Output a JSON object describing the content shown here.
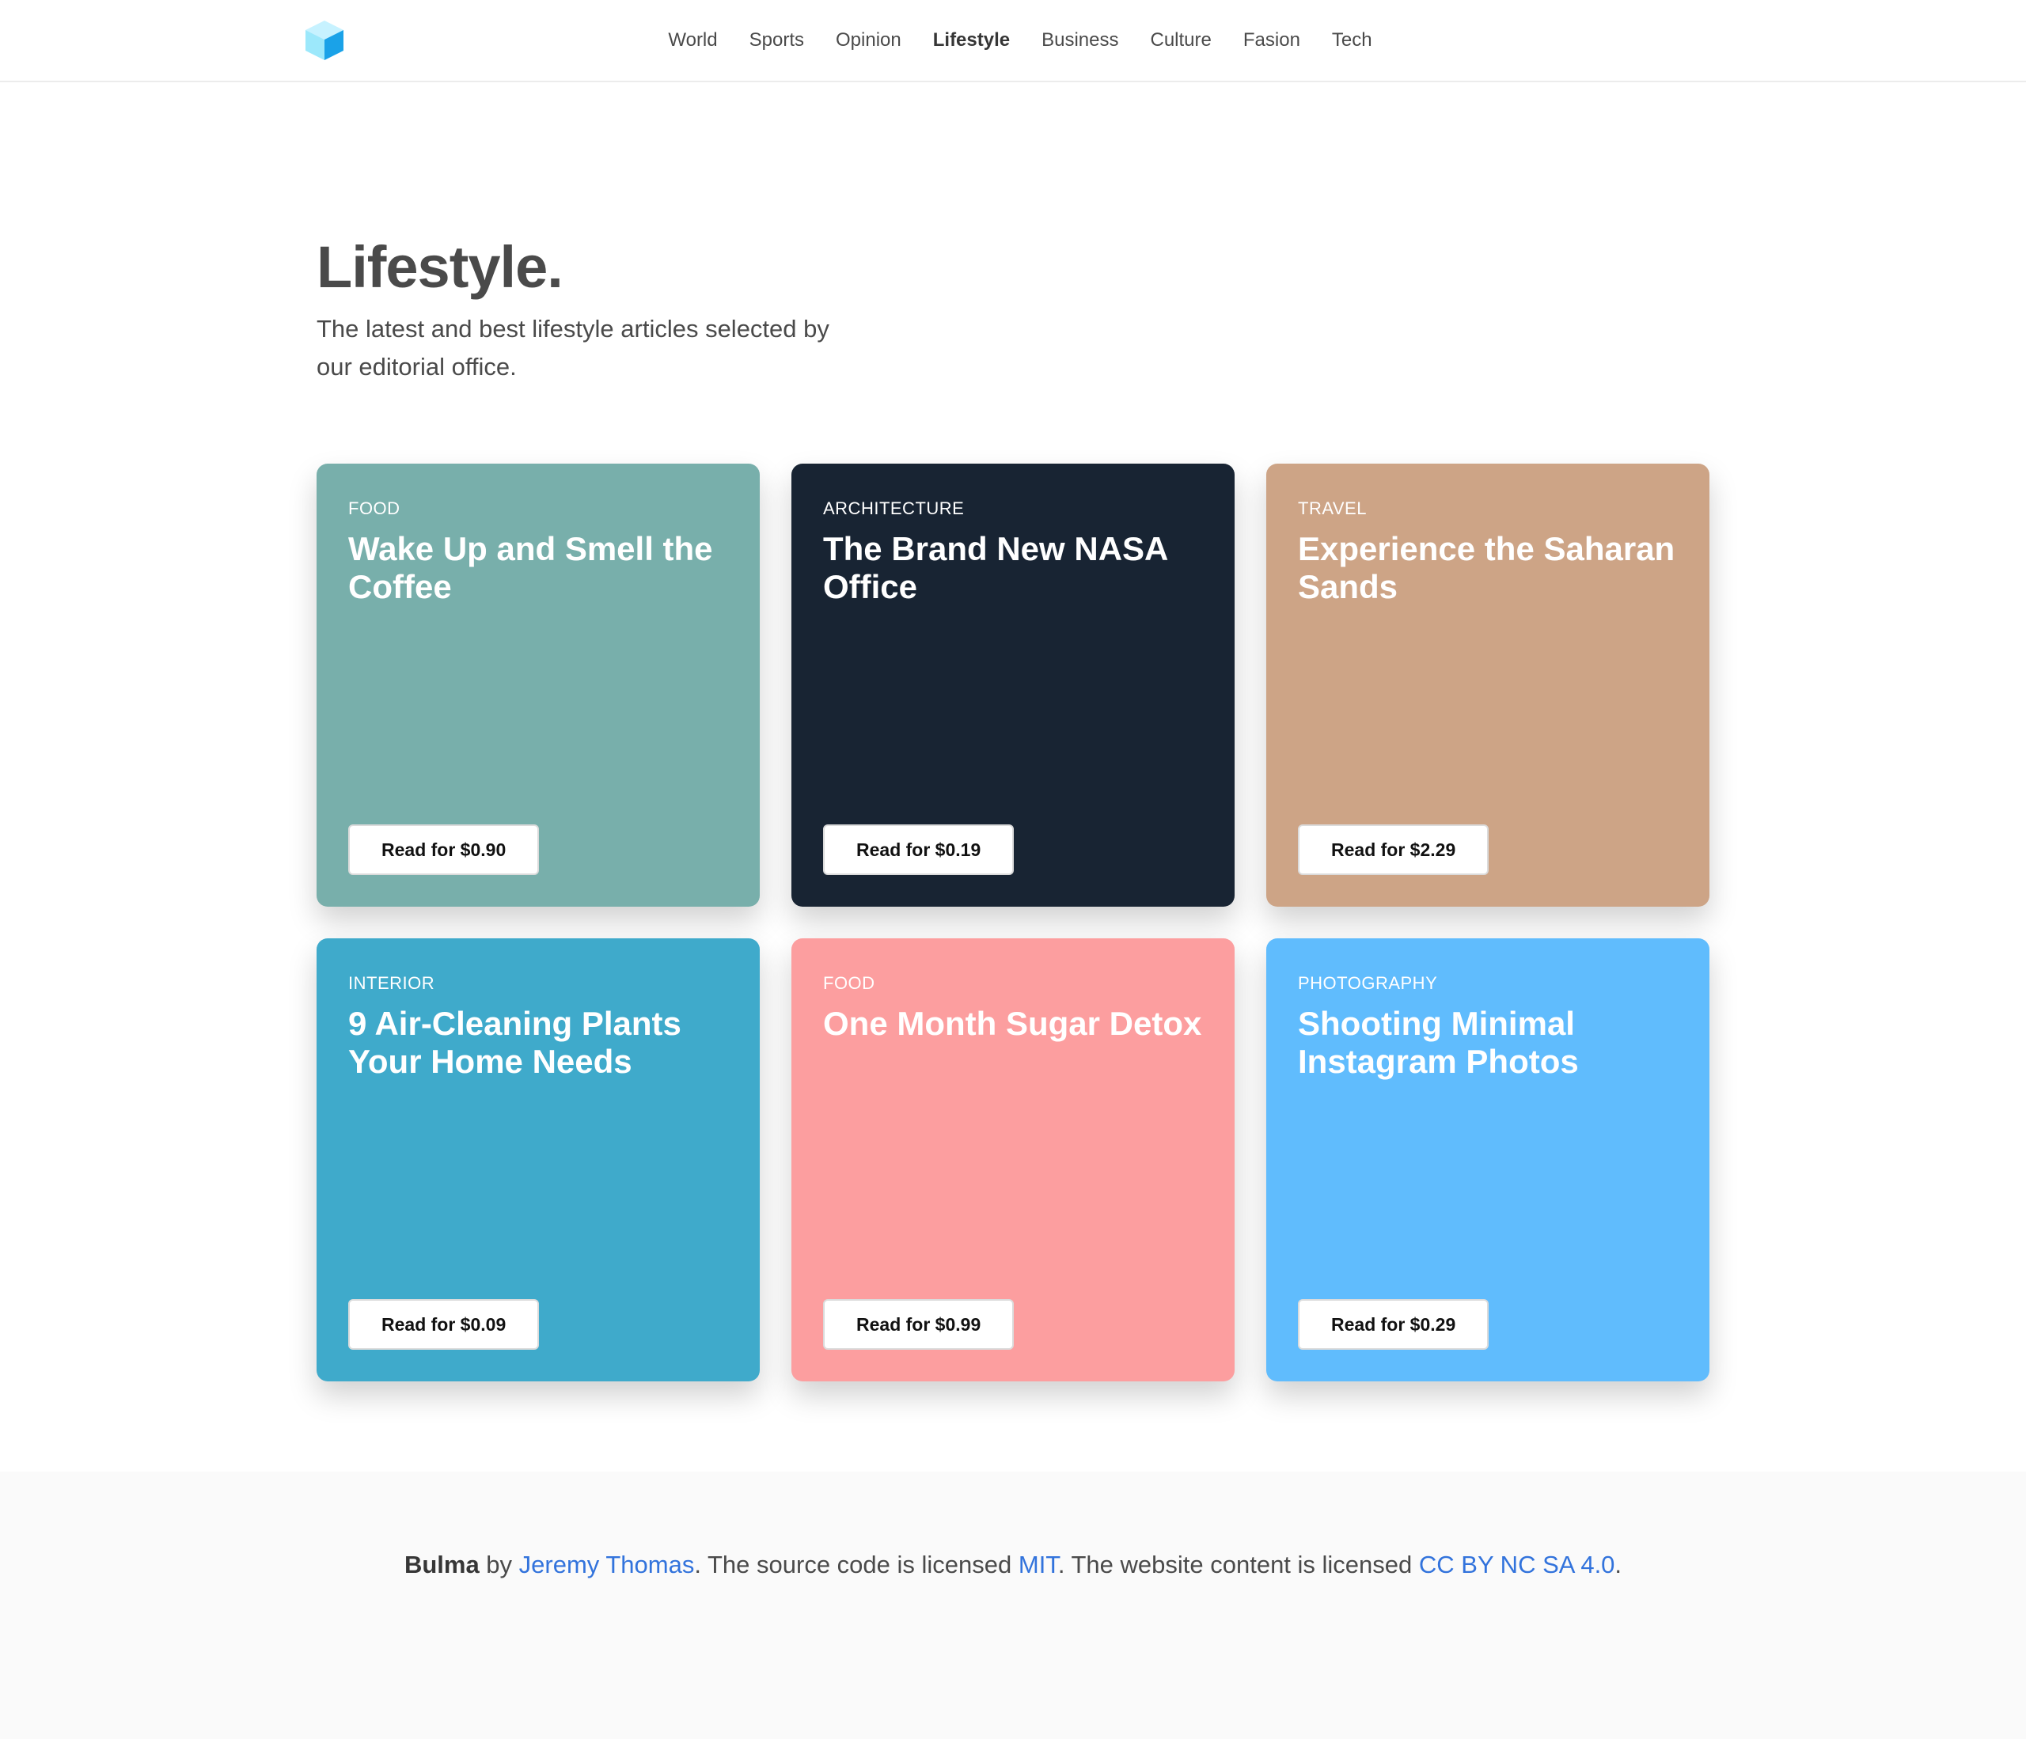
{
  "colors": {
    "text": "#4a4a4a",
    "link": "#3273dc",
    "footer_bg": "#fafafa",
    "logo_light": "#9ce8fb",
    "logo_dark": "#1aa2e8"
  },
  "logo": {
    "icon": "cube-logo-icon"
  },
  "nav": {
    "items": [
      {
        "label": "World"
      },
      {
        "label": "Sports"
      },
      {
        "label": "Opinion"
      },
      {
        "label": "Lifestyle",
        "active": true
      },
      {
        "label": "Business"
      },
      {
        "label": "Culture"
      },
      {
        "label": "Fasion"
      },
      {
        "label": "Tech"
      }
    ]
  },
  "hero": {
    "title": "Lifestyle.",
    "subtitle": "The latest and best lifestyle articles selected by our editorial office."
  },
  "cards": [
    {
      "category": "FOOD",
      "title": "Wake Up and Smell the Coffee",
      "button": "Read for $0.90",
      "color": "#78afab"
    },
    {
      "category": "ARCHITECTURE",
      "title": "The Brand New NASA Office",
      "button": "Read for $0.19",
      "color": "#182433"
    },
    {
      "category": "TRAVEL",
      "title": "Experience the Saharan Sands",
      "button": "Read for $2.29",
      "color": "#cda486"
    },
    {
      "category": "INTERIOR",
      "title": "9 Air-Cleaning Plants Your Home Needs",
      "button": "Read for $0.09",
      "color": "#3faacb"
    },
    {
      "category": "FOOD",
      "title": "One Month Sugar Detox",
      "button": "Read for $0.99",
      "color": "#fc9e9f"
    },
    {
      "category": "PHOTOGRAPHY",
      "title": "Shooting Minimal Instagram Photos",
      "button": "Read for $0.29",
      "color": "#60bcfd"
    }
  ],
  "footer": {
    "brand": "Bulma",
    "by": " by ",
    "author": "Jeremy Thomas",
    "text1": ". The source code is licensed ",
    "license_code": "MIT",
    "text2": ". The website content is licensed ",
    "license_content": "CC BY NC SA 4.0",
    "text3": "."
  }
}
